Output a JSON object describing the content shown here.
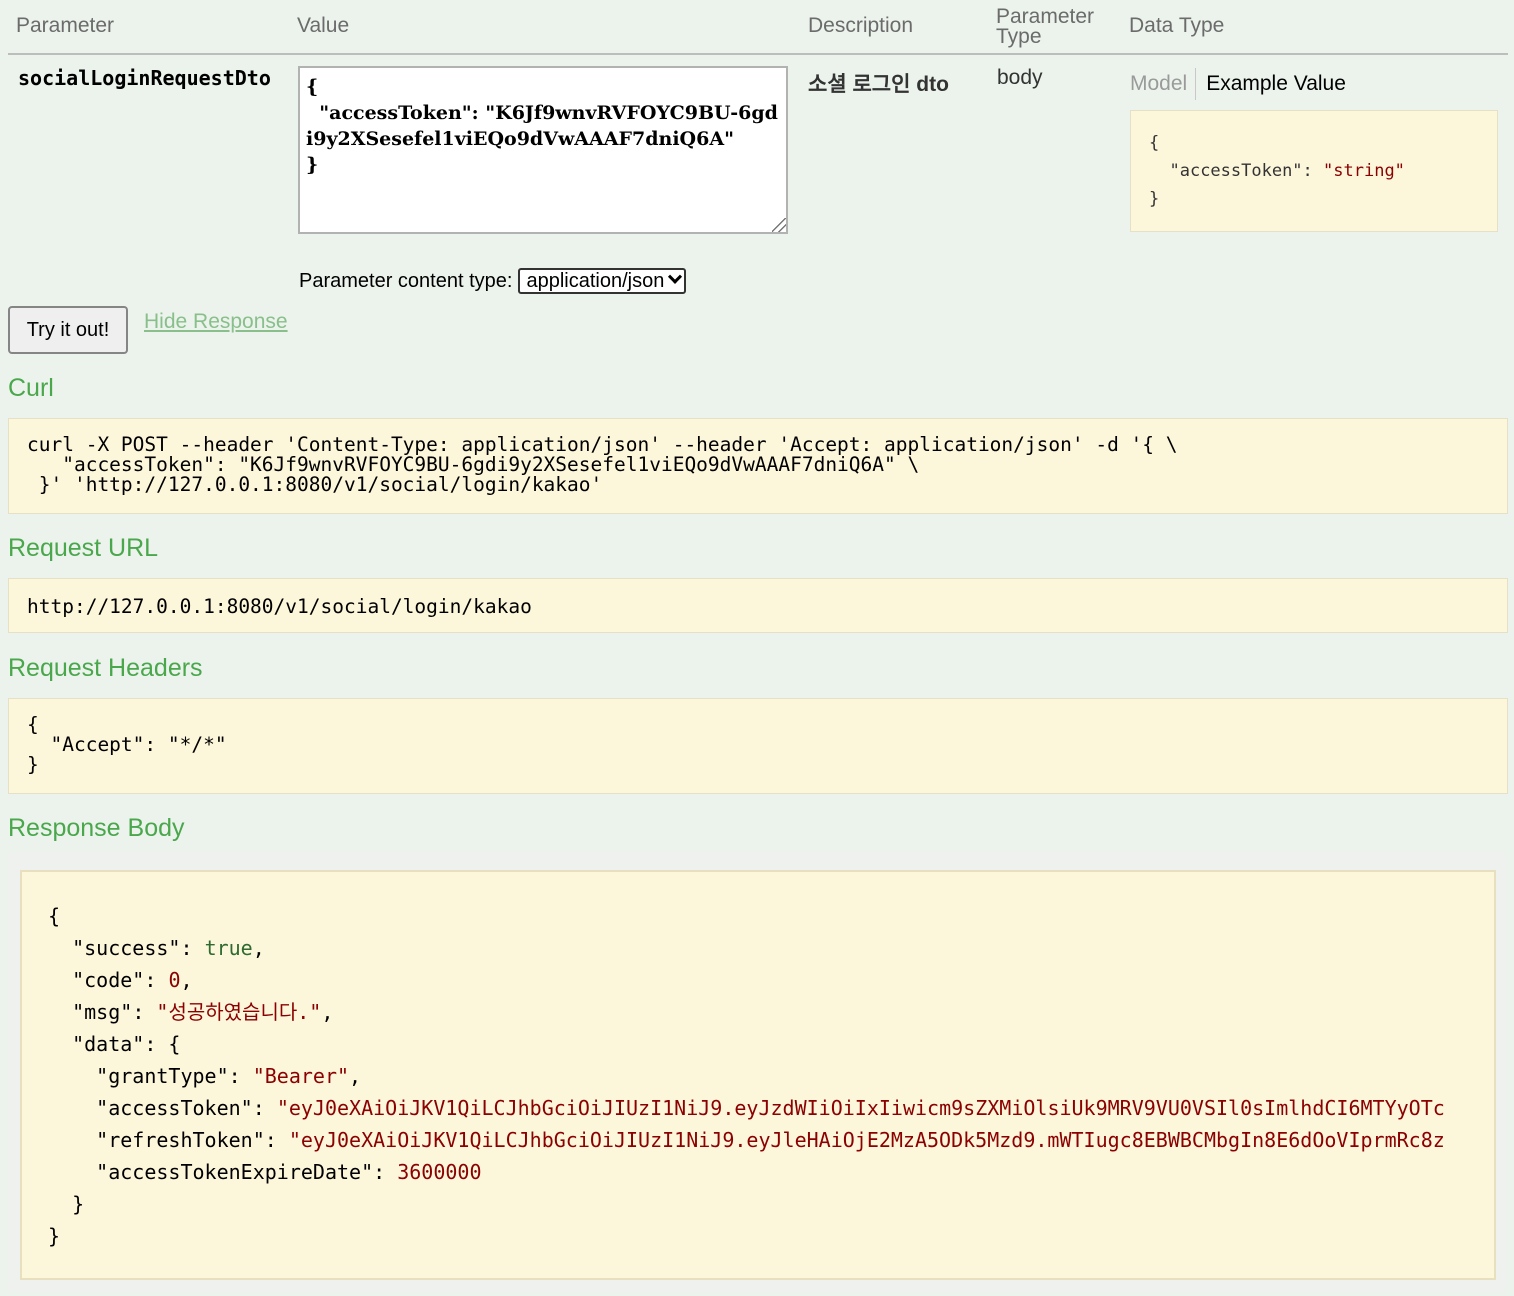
{
  "table_header": {
    "parameter": "Parameter",
    "value": "Value",
    "description": "Description",
    "parameter_type_line1": "Parameter",
    "parameter_type_line2": "Type",
    "data_type": "Data Type"
  },
  "param_row": {
    "name": "socialLoginRequestDto",
    "value_text": "{\n  \"accessToken\": \"K6Jf9wnvRVFOYC9BU-6gdi9y2XSesefel1viEQo9dVwAAAF7dniQ6A\"\n}",
    "description": "소셜 로그인 dto",
    "parameter_type": "body",
    "data_type_tabs": {
      "model": "Model",
      "example_value": "Example Value"
    },
    "example": {
      "open": "{",
      "key": "\"accessToken\"",
      "colon": ": ",
      "val": "\"string\"",
      "close": "}"
    },
    "content_type_label": "Parameter content type:",
    "content_type_selected": "application/json"
  },
  "actions": {
    "try_button": "Try it out!",
    "hide_response": "Hide Response"
  },
  "sections": {
    "curl_title": "Curl",
    "curl_text": "curl -X POST --header 'Content-Type: application/json' --header 'Accept: application/json' -d '{ \\\n   \"accessToken\": \"K6Jf9wnvRVFOYC9BU-6gdi9y2XSesefel1viEQo9dVwAAAF7dniQ6A\" \\\n }' 'http://127.0.0.1:8080/v1/social/login/kakao'",
    "request_url_title": "Request URL",
    "request_url": "http://127.0.0.1:8080/v1/social/login/kakao",
    "request_headers_title": "Request Headers",
    "request_headers_text": "{\n  \"Accept\": \"*/*\"\n}",
    "response_body_title": "Response Body"
  },
  "response": {
    "open": "{",
    "success_key": "\"success\"",
    "success_val": "true",
    "code_key": "\"code\"",
    "code_val": "0",
    "msg_key": "\"msg\"",
    "msg_val": "\"성공하였습니다.\"",
    "data_key": "\"data\"",
    "grant_key": "\"grantType\"",
    "grant_val": "\"Bearer\"",
    "access_key": "\"accessToken\"",
    "access_val": "\"eyJ0eXAiOiJKV1QiLCJhbGciOiJIUzI1NiJ9.eyJzdWIiOiIxIiwicm9sZXMiOlsiUk9MRV9VU0VSIl0sImlhdCI6MTYyOTc",
    "refresh_key": "\"refreshToken\"",
    "refresh_val": "\"eyJ0eXAiOiJKV1QiLCJhbGciOiJIUzI1NiJ9.eyJleHAiOjE2MzA5ODk5Mzd9.mWTIugc8EBWBCMbgIn8E6dOoVIprmRc8z",
    "expire_key": "\"accessTokenExpireDate\"",
    "expire_val": "3600000",
    "data_close": "}",
    "close": "}"
  },
  "colors": {
    "page_bg": "#ebf3ec",
    "section_title": "#4aa74c",
    "code_bg": "#fcf6db",
    "string_value": "#8b0000",
    "boolean_value": "#2f6a2f"
  }
}
